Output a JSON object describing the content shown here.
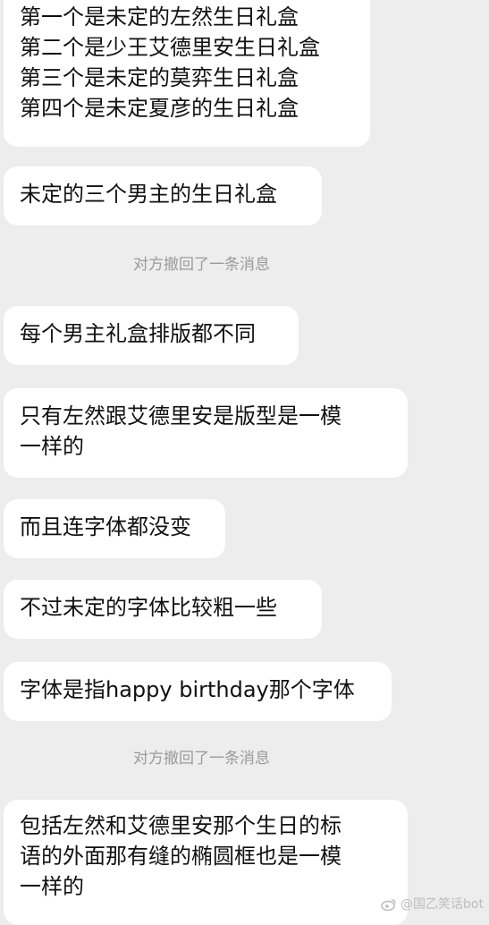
{
  "messages": [
    {
      "type": "bubble",
      "text": "第一个是未定的左然生日礼盒\n第二个是少王艾德里安生日礼盒\n第三个是未定的莫弈生日礼盒\n第四个是未定夏彦的生日礼盒"
    },
    {
      "type": "bubble",
      "text": "未定的三个男主的生日礼盒"
    },
    {
      "type": "system",
      "text": "对方撤回了一条消息"
    },
    {
      "type": "bubble",
      "text": "每个男主礼盒排版都不同"
    },
    {
      "type": "bubble",
      "text": "只有左然跟艾德里安是版型是一模\n一样的"
    },
    {
      "type": "bubble",
      "text": "而且连字体都没变"
    },
    {
      "type": "bubble",
      "text": "不过未定的字体比较粗一些"
    },
    {
      "type": "bubble",
      "text": "字体是指happy birthday那个字体"
    },
    {
      "type": "system",
      "text": "对方撤回了一条消息"
    },
    {
      "type": "bubble",
      "text": "包括左然和艾德里安那个生日的标\n语的外面那有缝的椭圆框也是一模\n一样的"
    }
  ],
  "watermark": {
    "text": "@国乙笑话bot",
    "icon": "weibo-icon"
  }
}
